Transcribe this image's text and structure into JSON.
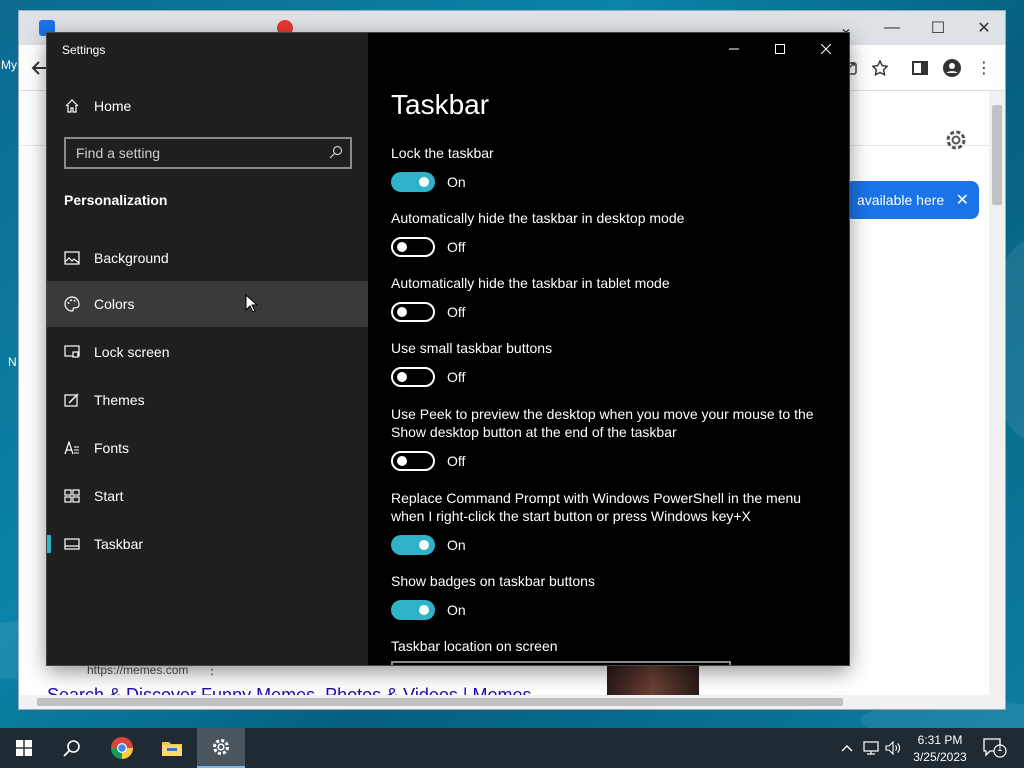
{
  "desktop": {
    "labels": [
      "My",
      "N"
    ]
  },
  "browser": {
    "bubble_text": "available here",
    "result_url": "https://memes.com",
    "result_title": "Search & Discover Funny Memes, Photos & Videos | Memes"
  },
  "settings": {
    "window_title": "Settings",
    "home_label": "Home",
    "search_placeholder": "Find a setting",
    "section_title": "Personalization",
    "nav_items": [
      {
        "label": "Background",
        "icon": "picture-icon"
      },
      {
        "label": "Colors",
        "icon": "palette-icon"
      },
      {
        "label": "Lock screen",
        "icon": "lock-screen-icon"
      },
      {
        "label": "Themes",
        "icon": "themes-icon"
      },
      {
        "label": "Fonts",
        "icon": "fonts-icon"
      },
      {
        "label": "Start",
        "icon": "start-icon"
      },
      {
        "label": "Taskbar",
        "icon": "taskbar-icon"
      }
    ],
    "selected_item": "Taskbar",
    "hovered_item": "Colors",
    "page_title": "Taskbar",
    "options": [
      {
        "label": "Lock the taskbar",
        "state": "On"
      },
      {
        "label": "Automatically hide the taskbar in desktop mode",
        "state": "Off"
      },
      {
        "label": "Automatically hide the taskbar in tablet mode",
        "state": "Off"
      },
      {
        "label": "Use small taskbar buttons",
        "state": "Off"
      },
      {
        "label": "Use Peek to preview the desktop when you move your mouse to the Show desktop button at the end of the taskbar",
        "state": "Off"
      },
      {
        "label": "Replace Command Prompt with Windows PowerShell in the menu when I right-click the start button or press Windows key+X",
        "state": "On"
      },
      {
        "label": "Show badges on taskbar buttons",
        "state": "On"
      }
    ],
    "location_label": "Taskbar location on screen",
    "accent_color": "#2fb3c9"
  },
  "taskbar": {
    "time": "6:31 PM",
    "date": "3/25/2023",
    "notification_count": "1",
    "pinned": [
      "start-icon",
      "search-icon",
      "chrome-icon",
      "file-explorer-icon",
      "settings-icon"
    ]
  }
}
